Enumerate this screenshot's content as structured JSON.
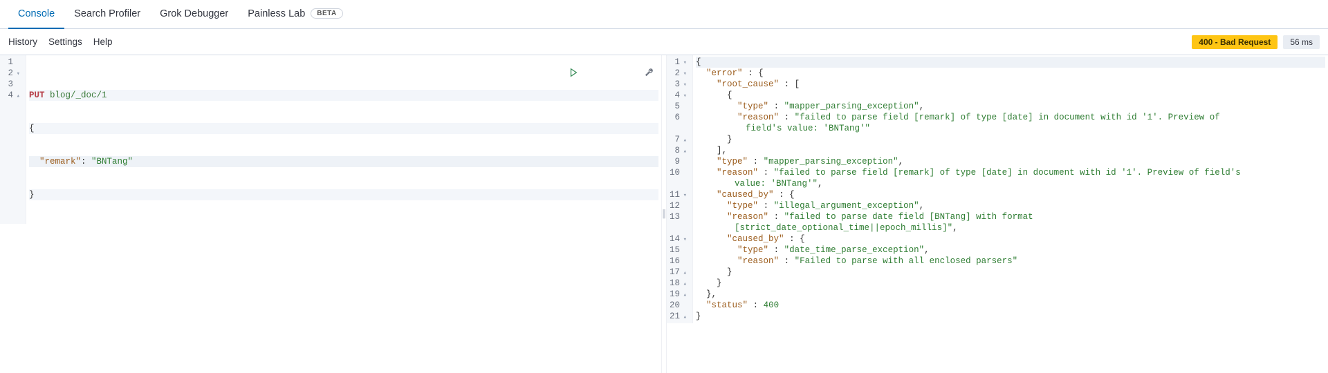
{
  "tabs": [
    {
      "label": "Console",
      "active": true
    },
    {
      "label": "Search Profiler",
      "active": false
    },
    {
      "label": "Grok Debugger",
      "active": false
    },
    {
      "label": "Painless Lab",
      "active": false,
      "beta": "BETA"
    }
  ],
  "toolbar": {
    "links": [
      "History",
      "Settings",
      "Help"
    ],
    "status": "400 - Bad Request",
    "time": "56 ms"
  },
  "request": {
    "method": "PUT",
    "path": "blog/_doc/1",
    "body_key": "\"remark\"",
    "body_val": "\"BNTang\"",
    "lines": [
      {
        "n": "1",
        "fold": ""
      },
      {
        "n": "2",
        "fold": "▾"
      },
      {
        "n": "3",
        "fold": ""
      },
      {
        "n": "4",
        "fold": "▴"
      }
    ]
  },
  "response": {
    "lines": [
      {
        "n": "1",
        "fold": "▾",
        "html": "<span class='punc'>{</span>"
      },
      {
        "n": "2",
        "fold": "▾",
        "html": "  <span class='key'>\"error\"</span> <span class='punc'>:</span> <span class='punc'>{</span>"
      },
      {
        "n": "3",
        "fold": "▾",
        "html": "    <span class='key'>\"root_cause\"</span> <span class='punc'>:</span> <span class='punc'>[</span>"
      },
      {
        "n": "4",
        "fold": "▾",
        "html": "      <span class='punc'>{</span>"
      },
      {
        "n": "5",
        "fold": "",
        "html": "        <span class='key'>\"type\"</span> <span class='punc'>:</span> <span class='str'>\"mapper_parsing_exception\"</span><span class='punc'>,</span>"
      },
      {
        "n": "6",
        "fold": "",
        "html": "        <span class='key'>\"reason\"</span> <span class='punc'>:</span> <span class='str'>\"failed to parse field [remark] of type [date] in document with id '1'. Preview of</span><span class='cont'><span class='str'>field's value: 'BNTang'\"</span></span>"
      },
      {
        "n": "7",
        "fold": "▴",
        "html": "      <span class='punc'>}</span>"
      },
      {
        "n": "8",
        "fold": "▴",
        "html": "    <span class='punc'>],</span>"
      },
      {
        "n": "9",
        "fold": "",
        "html": "    <span class='key'>\"type\"</span> <span class='punc'>:</span> <span class='str'>\"mapper_parsing_exception\"</span><span class='punc'>,</span>"
      },
      {
        "n": "10",
        "fold": "",
        "html": "    <span class='key'>\"reason\"</span> <span class='punc'>:</span> <span class='str'>\"failed to parse field [remark] of type [date] in document with id '1'. Preview of field's</span><span class='cont2'><span class='str'>value: 'BNTang'\"</span><span class='punc'>,</span></span>"
      },
      {
        "n": "11",
        "fold": "▾",
        "html": "    <span class='key'>\"caused_by\"</span> <span class='punc'>:</span> <span class='punc'>{</span>"
      },
      {
        "n": "12",
        "fold": "",
        "html": "      <span class='key'>\"type\"</span> <span class='punc'>:</span> <span class='str'>\"illegal_argument_exception\"</span><span class='punc'>,</span>"
      },
      {
        "n": "13",
        "fold": "",
        "html": "      <span class='key'>\"reason\"</span> <span class='punc'>:</span> <span class='str'>\"failed to parse date field [BNTang] with format</span><span class='cont2'><span class='str'>[strict_date_optional_time||epoch_millis]\"</span><span class='punc'>,</span></span>"
      },
      {
        "n": "14",
        "fold": "▾",
        "html": "      <span class='key'>\"caused_by\"</span> <span class='punc'>:</span> <span class='punc'>{</span>"
      },
      {
        "n": "15",
        "fold": "",
        "html": "        <span class='key'>\"type\"</span> <span class='punc'>:</span> <span class='str'>\"date_time_parse_exception\"</span><span class='punc'>,</span>"
      },
      {
        "n": "16",
        "fold": "",
        "html": "        <span class='key'>\"reason\"</span> <span class='punc'>:</span> <span class='str'>\"Failed to parse with all enclosed parsers\"</span>"
      },
      {
        "n": "17",
        "fold": "▴",
        "html": "      <span class='punc'>}</span>"
      },
      {
        "n": "18",
        "fold": "▴",
        "html": "    <span class='punc'>}</span>"
      },
      {
        "n": "19",
        "fold": "▴",
        "html": "  <span class='punc'>},</span>"
      },
      {
        "n": "20",
        "fold": "",
        "html": "  <span class='key'>\"status\"</span> <span class='punc'>:</span> <span class='num'>400</span>"
      },
      {
        "n": "21",
        "fold": "▴",
        "html": "<span class='punc'>}</span>"
      }
    ]
  }
}
